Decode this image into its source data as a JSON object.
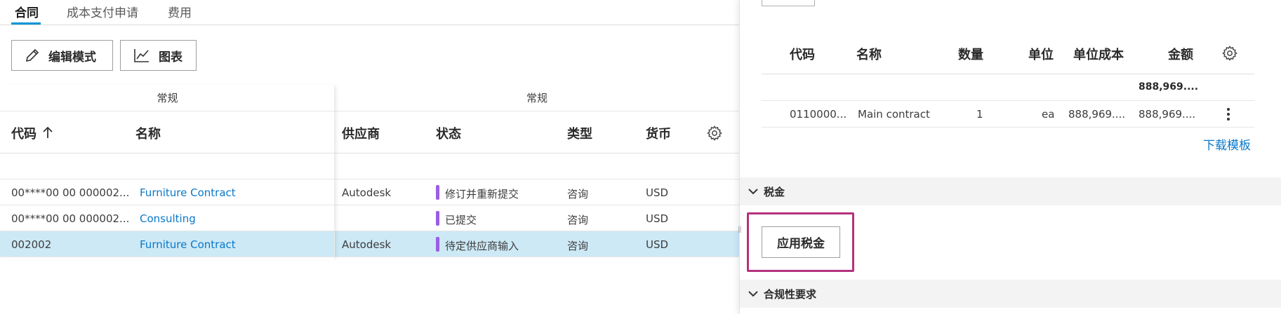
{
  "tabs": [
    {
      "label": "合同",
      "active": true
    },
    {
      "label": "成本支付申请",
      "active": false
    },
    {
      "label": "费用",
      "active": false
    }
  ],
  "toolbar": {
    "edit_mode_label": "编辑模式",
    "chart_label": "图表"
  },
  "grid": {
    "groups": [
      "常规",
      "常规"
    ],
    "columns": [
      "代码",
      "名称",
      "供应商",
      "状态",
      "类型",
      "货币"
    ],
    "sort_column": "代码",
    "sort_direction": "ascending",
    "rows": [
      {
        "code": "00****00 00 000002...",
        "name": "Furniture Contract",
        "supplier": "Autodesk",
        "status": "修订并重新提交",
        "type": "咨询",
        "currency": "USD",
        "selected": false
      },
      {
        "code": "00****00 00 000002...",
        "name": "Consulting",
        "supplier": "",
        "status": "已提交",
        "type": "咨询",
        "currency": "USD",
        "selected": false
      },
      {
        "code": "002002",
        "name": "Furniture Contract",
        "supplier": "Autodesk",
        "status": "待定供应商输入",
        "type": "咨询",
        "currency": "USD",
        "selected": true
      }
    ]
  },
  "line_items": {
    "columns": [
      "代码",
      "名称",
      "数量",
      "单位",
      "单位成本",
      "金额"
    ],
    "total_amount": "888,969....",
    "rows": [
      {
        "code": "0110000...",
        "name": "Main contract",
        "quantity": "1",
        "unit": "ea",
        "unit_cost": "888,969....",
        "amount": "888,969...."
      }
    ],
    "download_label": "下载模板"
  },
  "sections": {
    "tax_label": "税金",
    "apply_tax_label": "应用税金",
    "compliance_label": "合规性要求"
  },
  "colors": {
    "accent": "#0696d7",
    "link": "#0a78c8",
    "status_bar": "#9b5de5",
    "selected_row": "#cde9f6",
    "highlight": "#b5317d"
  }
}
